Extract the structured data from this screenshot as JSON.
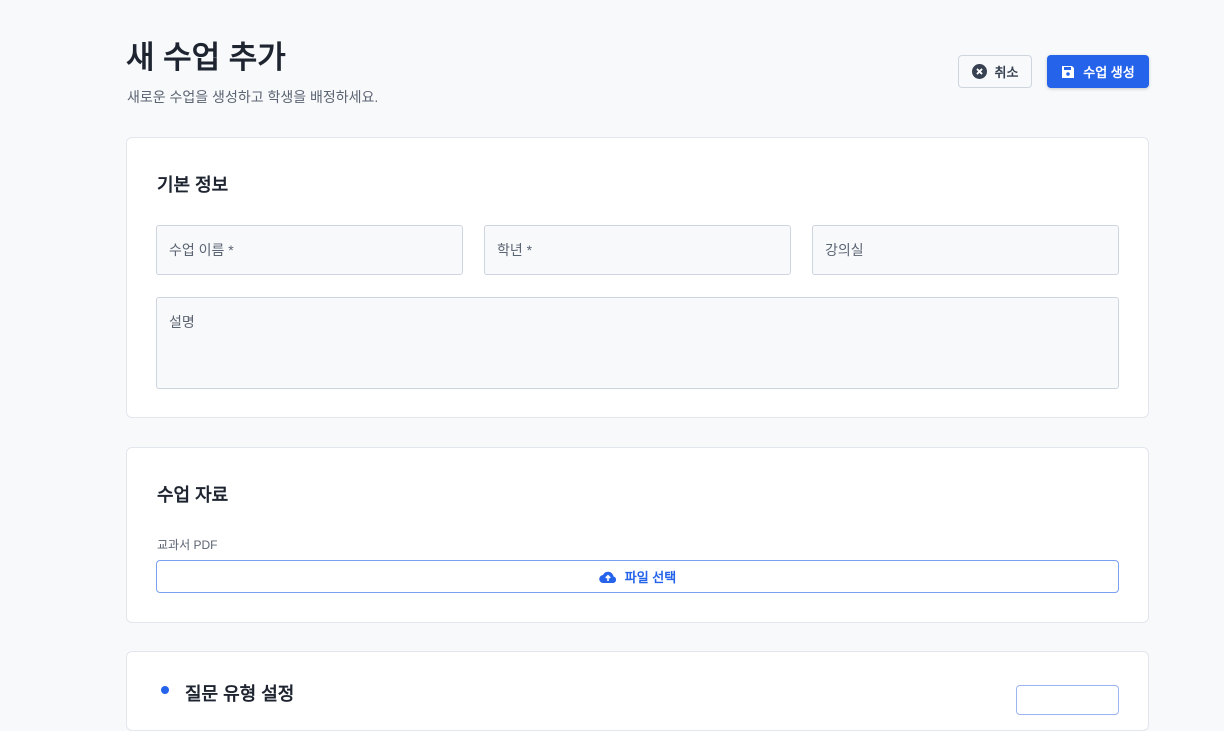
{
  "header": {
    "title": "새 수업 추가",
    "subtitle": "새로운 수업을 생성하고 학생을 배정하세요.",
    "cancel_label": "취소",
    "create_label": "수업 생성"
  },
  "basic_info": {
    "title": "기본 정보",
    "fields": {
      "name": "수업 이름 *",
      "grade": "학년 *",
      "room": "강의실",
      "description": "설명"
    }
  },
  "materials": {
    "title": "수업 자료",
    "pdf_label": "교과서 PDF",
    "upload_label": "파일 선택"
  },
  "question_types": {
    "title": "질문 유형 설정"
  },
  "colors": {
    "primary": "#2563eb"
  }
}
